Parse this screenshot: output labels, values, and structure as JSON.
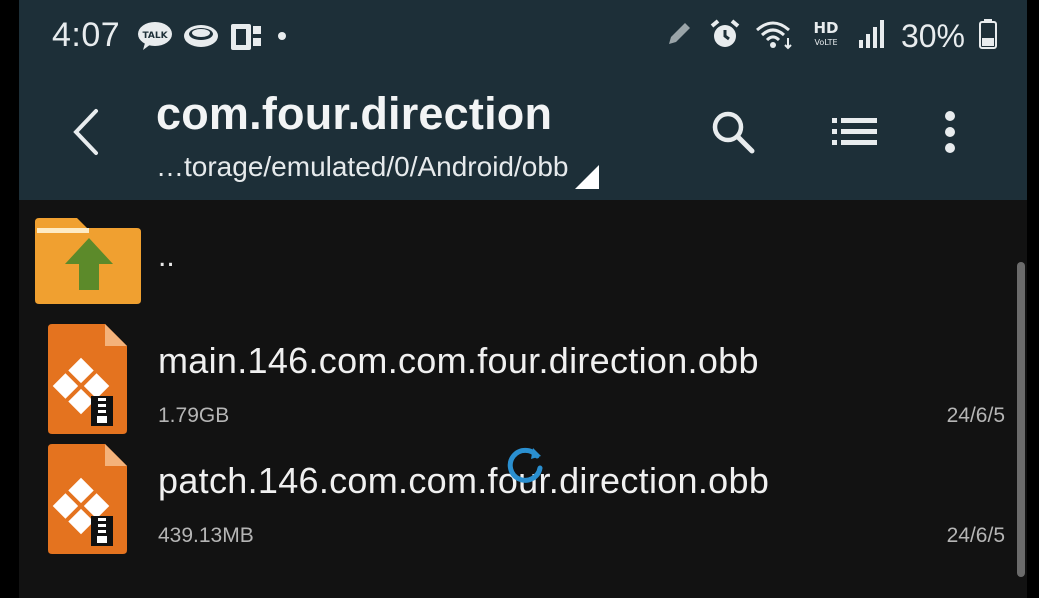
{
  "status_bar": {
    "time": "4:07",
    "talk_icon_label": "TALK",
    "battery_percent": "30%",
    "hd_label": "HD",
    "hd_sub": "VoLTE",
    "left_icons": [
      "talk-icon",
      "chat-bubble-icon",
      "notification-icon",
      "dot-icon"
    ],
    "right_icons": [
      "pen-icon",
      "alarm-icon",
      "wifi-icon",
      "hd-voice-icon",
      "signal-icon",
      "battery-icon"
    ]
  },
  "toolbar": {
    "title": "com.four.direction",
    "path": "…torage/emulated/0/Android/obb",
    "icons": [
      "back-icon",
      "search-icon",
      "list-view-icon",
      "more-vert-icon"
    ]
  },
  "list": {
    "parent_label": "..",
    "files": [
      {
        "name": "main.146.com.com.four.direction.obb",
        "size": "1.79GB",
        "date": "24/6/5"
      },
      {
        "name": "patch.146.com.com.four.direction.obb",
        "size": "439.13MB",
        "date": "24/6/5"
      }
    ]
  },
  "colors": {
    "header_bg": "#1d2f38",
    "list_bg": "#121212",
    "folder_orange": "#f0a030",
    "file_orange": "#e4731f",
    "arrow_green": "#5c8a2a",
    "spinner_blue": "#2a8fd0"
  }
}
